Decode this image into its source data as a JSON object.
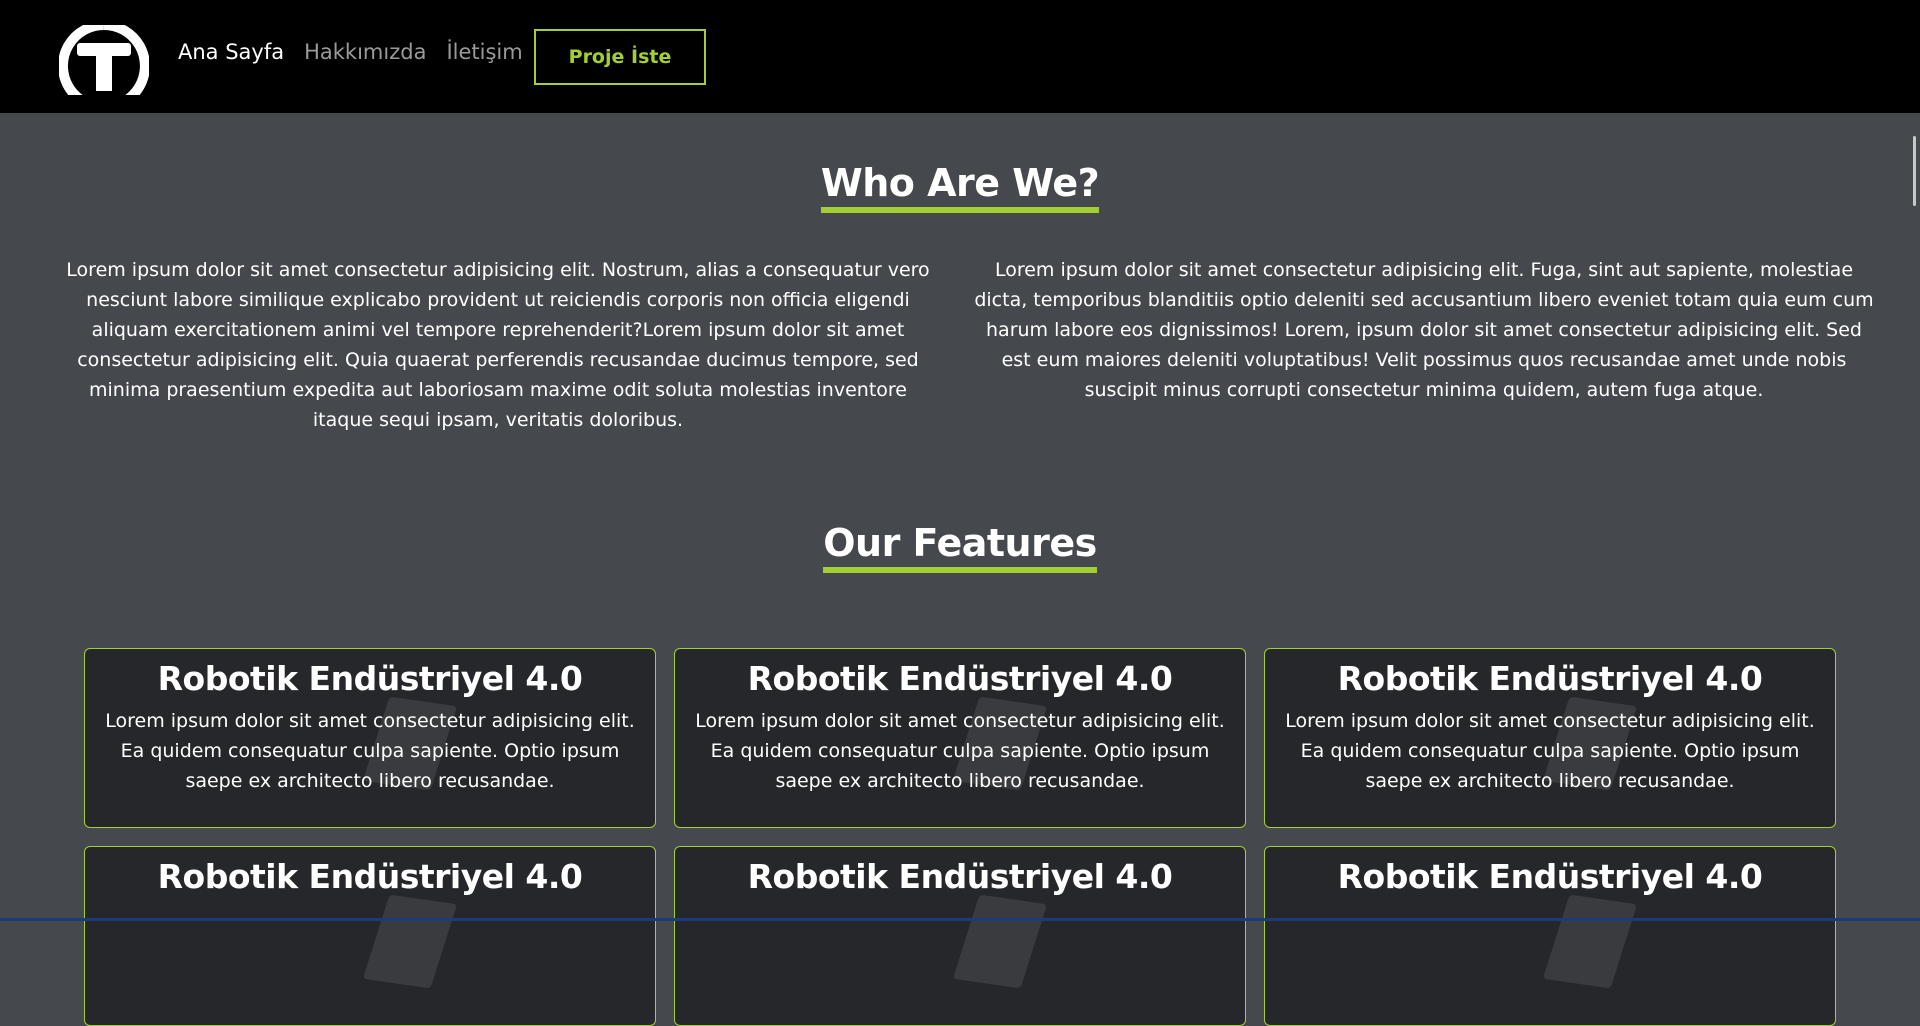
{
  "header": {
    "logo_icon": "t-circle-logo",
    "nav": [
      {
        "label": "Ana Sayfa",
        "active": true
      },
      {
        "label": "Hakkımızda",
        "active": false
      },
      {
        "label": "İletişim",
        "active": false
      }
    ],
    "cta_label": "Proje İste"
  },
  "about": {
    "title": "Who Are We?",
    "left_text": "Lorem ipsum dolor sit amet consectetur adipisicing elit. Nostrum, alias a consequatur vero nesciunt labore similique explicabo provident ut reiciendis corporis non officia eligendi aliquam exercitationem animi vel tempore reprehenderit?Lorem ipsum dolor sit amet consectetur adipisicing elit. Quia quaerat perferendis recusandae ducimus tempore, sed minima praesentium expedita aut laboriosam maxime odit soluta molestias inventore itaque sequi ipsam, veritatis doloribus.",
    "right_text": "Lorem ipsum dolor sit amet consectetur adipisicing elit. Fuga, sint aut sapiente, molestiae dicta, temporibus blanditiis optio deleniti sed accusantium libero eveniet totam quia eum cum harum labore eos dignissimos! Lorem, ipsum dolor sit amet consectetur adipisicing elit. Sed est eum maiores deleniti voluptatibus! Velit possimus quos recusandae amet unde nobis suscipit minus corrupti consectetur minima quidem, autem fuga atque."
  },
  "features": {
    "title": "Our Features",
    "cards": [
      {
        "title": "Robotik Endüstriyel 4.0",
        "text": "Lorem ipsum dolor sit amet consectetur adipisicing elit. Ea quidem consequatur culpa sapiente. Optio ipsum saepe ex architecto libero recusandae."
      },
      {
        "title": "Robotik Endüstriyel 4.0",
        "text": "Lorem ipsum dolor sit amet consectetur adipisicing elit. Ea quidem consequatur culpa sapiente. Optio ipsum saepe ex architecto libero recusandae."
      },
      {
        "title": "Robotik Endüstriyel 4.0",
        "text": "Lorem ipsum dolor sit amet consectetur adipisicing elit. Ea quidem consequatur culpa sapiente. Optio ipsum saepe ex architecto libero recusandae."
      },
      {
        "title": "Robotik Endüstriyel 4.0",
        "text": ""
      },
      {
        "title": "Robotik Endüstriyel 4.0",
        "text": ""
      },
      {
        "title": "Robotik Endüstriyel 4.0",
        "text": ""
      }
    ]
  },
  "colors": {
    "accent": "#a3cf35",
    "page_bg": "#45484c",
    "header_bg": "#000000",
    "card_bg": "#26272a"
  }
}
